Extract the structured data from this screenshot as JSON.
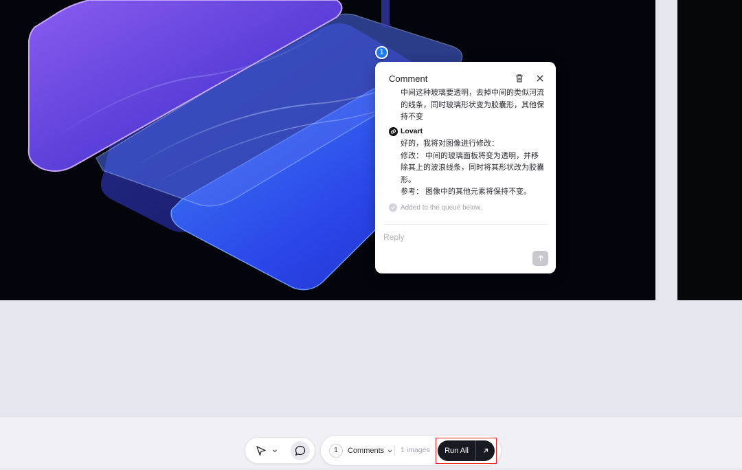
{
  "canvas": {
    "artwork_colors": {
      "background": "#03040c",
      "glass_violet": "#7a52e6",
      "glass_blue": "#2d49f0"
    }
  },
  "comment_pin": {
    "number": "1",
    "color": "#1f7cf0"
  },
  "comment_popup": {
    "title": "Comment",
    "trash_icon": "trash-icon",
    "close_icon": "close-icon",
    "comment_text": "中间这种玻璃要透明，去掉中间的类似河流的线条，同时玻璃形状变为胶囊形，其他保持不变",
    "author_name": "Lovart",
    "reply_lines": [
      "好的，我将对图像进行修改：",
      "修改： 中间的玻璃面板将变为透明，并移除其上的波浪线条，同时将其形状改为胶囊形。",
      "参考： 图像中的其他元素将保持不变。"
    ],
    "status_text": "Added to the queue below.",
    "reply_placeholder": "Reply",
    "send_icon": "arrow-up-icon"
  },
  "bottom_toolbar": {
    "select_tool_icon": "pointer-icon",
    "comment_tool_icon": "comment-bubble-icon",
    "queue": {
      "count": "1",
      "comments_label": "Comments",
      "images_label": "1 images",
      "run_all_label": "Run All",
      "expand_icon": "arrow-up-right-icon"
    },
    "highlight_color": "#e02424"
  }
}
